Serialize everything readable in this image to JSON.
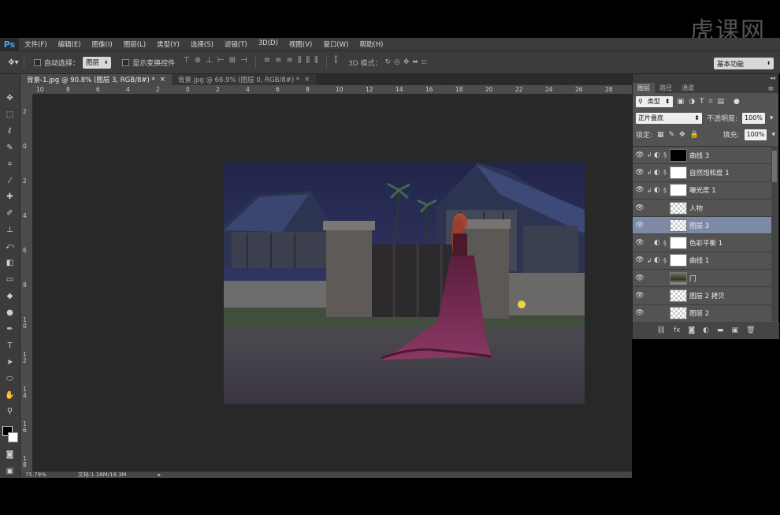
{
  "watermark": "虎课网",
  "app_logo": "Ps",
  "menu": [
    "文件(F)",
    "编辑(E)",
    "图像(I)",
    "图层(L)",
    "类型(Y)",
    "选择(S)",
    "滤镜(T)",
    "3D(D)",
    "视图(V)",
    "窗口(W)",
    "帮助(H)"
  ],
  "options": {
    "auto_select_label": "自动选择：",
    "auto_select_value": "图层",
    "show_transform_label": "显示变换控件",
    "mode_3d_label": "3D 模式：",
    "workspace": "基本功能"
  },
  "tabs": [
    {
      "label": "背景-1.jpg @ 90.8% (图层 3, RGB/8#) *",
      "close": "×"
    },
    {
      "label": "背景.jpg @ 66.9% (图层 0, RGB/8#) *",
      "close": "×"
    }
  ],
  "ruler_top": [
    "10",
    "8",
    "6",
    "4",
    "2",
    "0",
    "2",
    "4",
    "6",
    "8",
    "10",
    "12",
    "14",
    "16",
    "18",
    "20",
    "22",
    "24",
    "26",
    "28"
  ],
  "ruler_left": [
    "2",
    "0",
    "2",
    "4",
    "6",
    "8",
    "1\n0",
    "1\n2",
    "1\n4",
    "1\n6",
    "1\n8"
  ],
  "status": {
    "zoom": "75.79%",
    "doc": "文档:1.16M/18.3M"
  },
  "panel": {
    "tabs": [
      "图层",
      "路径",
      "通道"
    ],
    "filter_kind": "类型",
    "blend_mode": "正片叠底",
    "opacity_label": "不透明度:",
    "opacity_value": "100%",
    "lock_label": "锁定:",
    "fill_label": "填充:",
    "fill_value": "100%",
    "layers": [
      {
        "name": "曲线 3",
        "thumb": "dark",
        "clip": true,
        "adj": true,
        "selected": false
      },
      {
        "name": "自然饱和度 1",
        "thumb": "white",
        "clip": true,
        "adj": true,
        "selected": false
      },
      {
        "name": "曝光度 1",
        "thumb": "white",
        "clip": true,
        "adj": true,
        "selected": false
      },
      {
        "name": "人物",
        "thumb": "trans",
        "clip": false,
        "adj": false,
        "selected": false
      },
      {
        "name": "图层 3",
        "thumb": "trans",
        "clip": false,
        "adj": false,
        "selected": true
      },
      {
        "name": "色彩平衡 1",
        "thumb": "white",
        "clip": false,
        "adj": true,
        "selected": false
      },
      {
        "name": "曲线 1",
        "thumb": "white",
        "clip": true,
        "adj": true,
        "selected": false
      },
      {
        "name": "门",
        "thumb": "photo",
        "clip": false,
        "adj": false,
        "selected": false
      },
      {
        "name": "图层 2 拷贝",
        "thumb": "trans",
        "clip": false,
        "adj": false,
        "selected": false
      },
      {
        "name": "图层 2",
        "thumb": "trans",
        "clip": false,
        "adj": false,
        "selected": false
      }
    ]
  }
}
